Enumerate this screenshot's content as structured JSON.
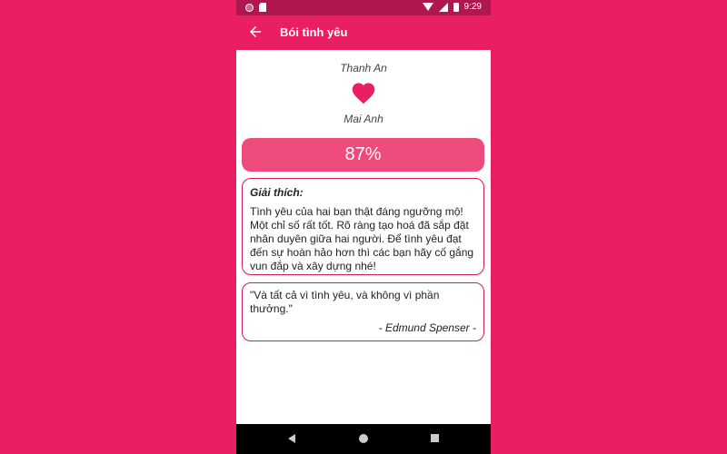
{
  "status_bar": {
    "time": "9:29"
  },
  "app_bar": {
    "title": "Bói tình yêu",
    "back_icon": "arrow-left-icon"
  },
  "couple": {
    "name1": "Thanh An",
    "name2": "Mai Anh",
    "heart_icon": "heart-icon"
  },
  "result": {
    "percent": "87%"
  },
  "explanation": {
    "heading": "Giải thích:",
    "text": "Tình yêu của hai bạn thật đáng ngưỡng mộ! Một chỉ số rất tốt. Rõ ràng tạo hoá đã sắp đặt nhân duyên giữa hai người. Để tình yêu đạt đến sự hoàn hảo hơn thì các bạn hãy cố gắng vun đắp và xây dựng nhé!"
  },
  "quote": {
    "text": "\"Và tất cả vì tình yêu, và không vì phần thưởng.\"",
    "author": "- Edmund Spenser -"
  },
  "colors": {
    "accent": "#e91e63",
    "status_bar": "#b0174e",
    "percent_bg": "#ed4b7c",
    "card_border": "#d31c58"
  }
}
